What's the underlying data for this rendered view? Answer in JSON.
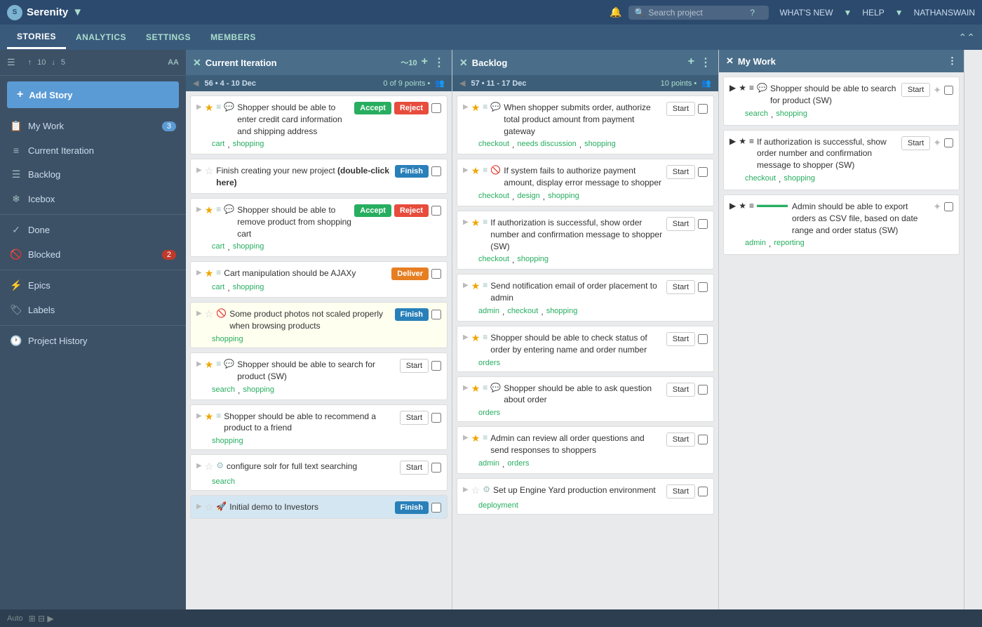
{
  "app": {
    "name": "Serenity",
    "logo_text": "S"
  },
  "top_nav": {
    "search_placeholder": "Search project",
    "bell_label": "🔔",
    "question_label": "?",
    "what_new": "WHAT'S NEW",
    "help": "HELP",
    "user": "NATHANSWAIN"
  },
  "sub_nav": {
    "tabs": [
      {
        "label": "STORIES",
        "active": true
      },
      {
        "label": "ANALYTICS",
        "active": false
      },
      {
        "label": "SETTINGS",
        "active": false
      },
      {
        "label": "MEMBERS",
        "active": false
      }
    ]
  },
  "sidebar": {
    "stats_up": "10",
    "stats_down": "5",
    "aa_label": "AA",
    "add_story_label": "Add Story",
    "nav_items": [
      {
        "id": "my-work",
        "icon": "📋",
        "label": "My Work",
        "badge": "3",
        "badge_type": "blue"
      },
      {
        "id": "current-iteration",
        "icon": "≡",
        "label": "Current Iteration",
        "badge": null
      },
      {
        "id": "backlog",
        "icon": "☰",
        "label": "Backlog",
        "badge": null
      },
      {
        "id": "icebox",
        "icon": "❄",
        "label": "Icebox",
        "badge": null
      },
      {
        "id": "done",
        "icon": "✓",
        "label": "Done",
        "badge": null
      },
      {
        "id": "blocked",
        "icon": "🚫",
        "label": "Blocked",
        "badge": "2",
        "badge_type": "red"
      },
      {
        "id": "epics",
        "icon": "⚡",
        "label": "Epics",
        "badge": null
      },
      {
        "id": "labels",
        "icon": "🏷",
        "label": "Labels",
        "badge": null
      },
      {
        "id": "project-history",
        "icon": "🕐",
        "label": "Project History",
        "badge": null
      }
    ]
  },
  "current_iteration": {
    "title": "Current Iteration",
    "wave": "10",
    "sprint_label": "56 • 4 - 10 Dec",
    "points_label": "0 of 9 points •",
    "stories": [
      {
        "id": "ci-1",
        "star": true,
        "icons": [
          "list",
          "chat"
        ],
        "text": "Shopper should be able to enter credit card information and shipping address",
        "tags": [
          "cart",
          "shopping"
        ],
        "action": "accept_reject",
        "status": ""
      },
      {
        "id": "ci-2",
        "star": false,
        "icons": [],
        "text": "Finish creating your new project (double-click here)",
        "tags": [],
        "action": "finish",
        "status": ""
      },
      {
        "id": "ci-3",
        "star": true,
        "icons": [
          "list",
          "chat"
        ],
        "text": "Shopper should be able to remove product from shopping cart",
        "tags": [
          "cart",
          "shopping"
        ],
        "action": "accept_reject",
        "status": ""
      },
      {
        "id": "ci-4",
        "star": true,
        "icons": [
          "list"
        ],
        "text": "Cart manipulation should be AJAXy",
        "tags": [
          "cart",
          "shopping"
        ],
        "action": "deliver",
        "status": ""
      },
      {
        "id": "ci-5",
        "star": false,
        "icons": [
          "blocked"
        ],
        "text": "Some product photos not scaled properly when browsing products",
        "tags": [
          "shopping"
        ],
        "action": "finish",
        "status": "",
        "yellow": true
      },
      {
        "id": "ci-6",
        "star": true,
        "icons": [
          "list",
          "chat"
        ],
        "text": "Shopper should be able to search for product (SW)",
        "tags": [
          "search",
          "shopping"
        ],
        "action": "start",
        "status": ""
      },
      {
        "id": "ci-7",
        "star": true,
        "icons": [
          "list"
        ],
        "text": "Shopper should be able to recommend a product to a friend",
        "tags": [
          "shopping"
        ],
        "action": "start",
        "status": ""
      },
      {
        "id": "ci-8",
        "star": false,
        "icons": [
          "gear"
        ],
        "text": "configure solr for full text searching",
        "tags": [
          "search"
        ],
        "action": "start",
        "status": ""
      },
      {
        "id": "ci-9",
        "star": false,
        "icons": [
          "rocket"
        ],
        "text": "Initial demo to Investors",
        "tags": [],
        "action": "finish",
        "status": "",
        "bottom": true
      }
    ]
  },
  "backlog": {
    "title": "Backlog",
    "sprint_label": "57 • 11 - 17 Dec",
    "points_label": "10 points •",
    "stories": [
      {
        "id": "bl-1",
        "star": true,
        "icons": [
          "list",
          "chat"
        ],
        "text": "When shopper submits order, authorize total product amount from payment gateway",
        "tags": [
          "checkout",
          "needs discussion",
          "shopping"
        ],
        "action": "start"
      },
      {
        "id": "bl-2",
        "star": true,
        "icons": [
          "list",
          "blocked"
        ],
        "text": "If system fails to authorize payment amount, display error message to shopper",
        "tags": [
          "checkout",
          "design",
          "shopping"
        ],
        "action": "start"
      },
      {
        "id": "bl-3",
        "star": true,
        "icons": [
          "list"
        ],
        "text": "If authorization is successful, show order number and confirmation message to shopper (SW)",
        "tags": [
          "checkout",
          "shopping"
        ],
        "action": "start"
      },
      {
        "id": "bl-4",
        "star": true,
        "icons": [
          "list"
        ],
        "text": "Send notification email of order placement to admin",
        "tags": [
          "admin",
          "checkout",
          "shopping"
        ],
        "action": "start"
      },
      {
        "id": "bl-5",
        "star": true,
        "icons": [
          "list"
        ],
        "text": "Shopper should be able to check status of order by entering name and order number",
        "tags": [
          "orders"
        ],
        "action": "start"
      },
      {
        "id": "bl-6",
        "star": true,
        "icons": [
          "list",
          "chat"
        ],
        "text": "Shopper should be able to ask question about order",
        "tags": [
          "orders"
        ],
        "action": "start"
      },
      {
        "id": "bl-7",
        "star": true,
        "icons": [
          "list"
        ],
        "text": "Admin can review all order questions and send responses to shoppers",
        "tags": [
          "admin",
          "orders"
        ],
        "action": "start"
      },
      {
        "id": "bl-8",
        "star": false,
        "icons": [
          "gear"
        ],
        "text": "Set up Engine Yard production environment",
        "tags": [
          "deployment"
        ],
        "action": "start"
      }
    ]
  },
  "my_work": {
    "title": "My Work",
    "stories": [
      {
        "id": "mw-1",
        "star": true,
        "text": "Shopper should be able to search for product (SW)",
        "tags": [
          "search",
          "shopping"
        ],
        "action": "start"
      },
      {
        "id": "mw-2",
        "star": true,
        "text": "If authorization is successful, show order number and confirmation message to shopper (SW)",
        "tags": [
          "checkout",
          "shopping"
        ],
        "action": "start"
      },
      {
        "id": "mw-3",
        "star": true,
        "text": "Admin should be able to export orders as CSV file, based on date range and order status (SW)",
        "tags": [
          "admin",
          "reporting"
        ],
        "action": "none"
      }
    ]
  },
  "bottom_bar": {
    "label": "Auto"
  }
}
